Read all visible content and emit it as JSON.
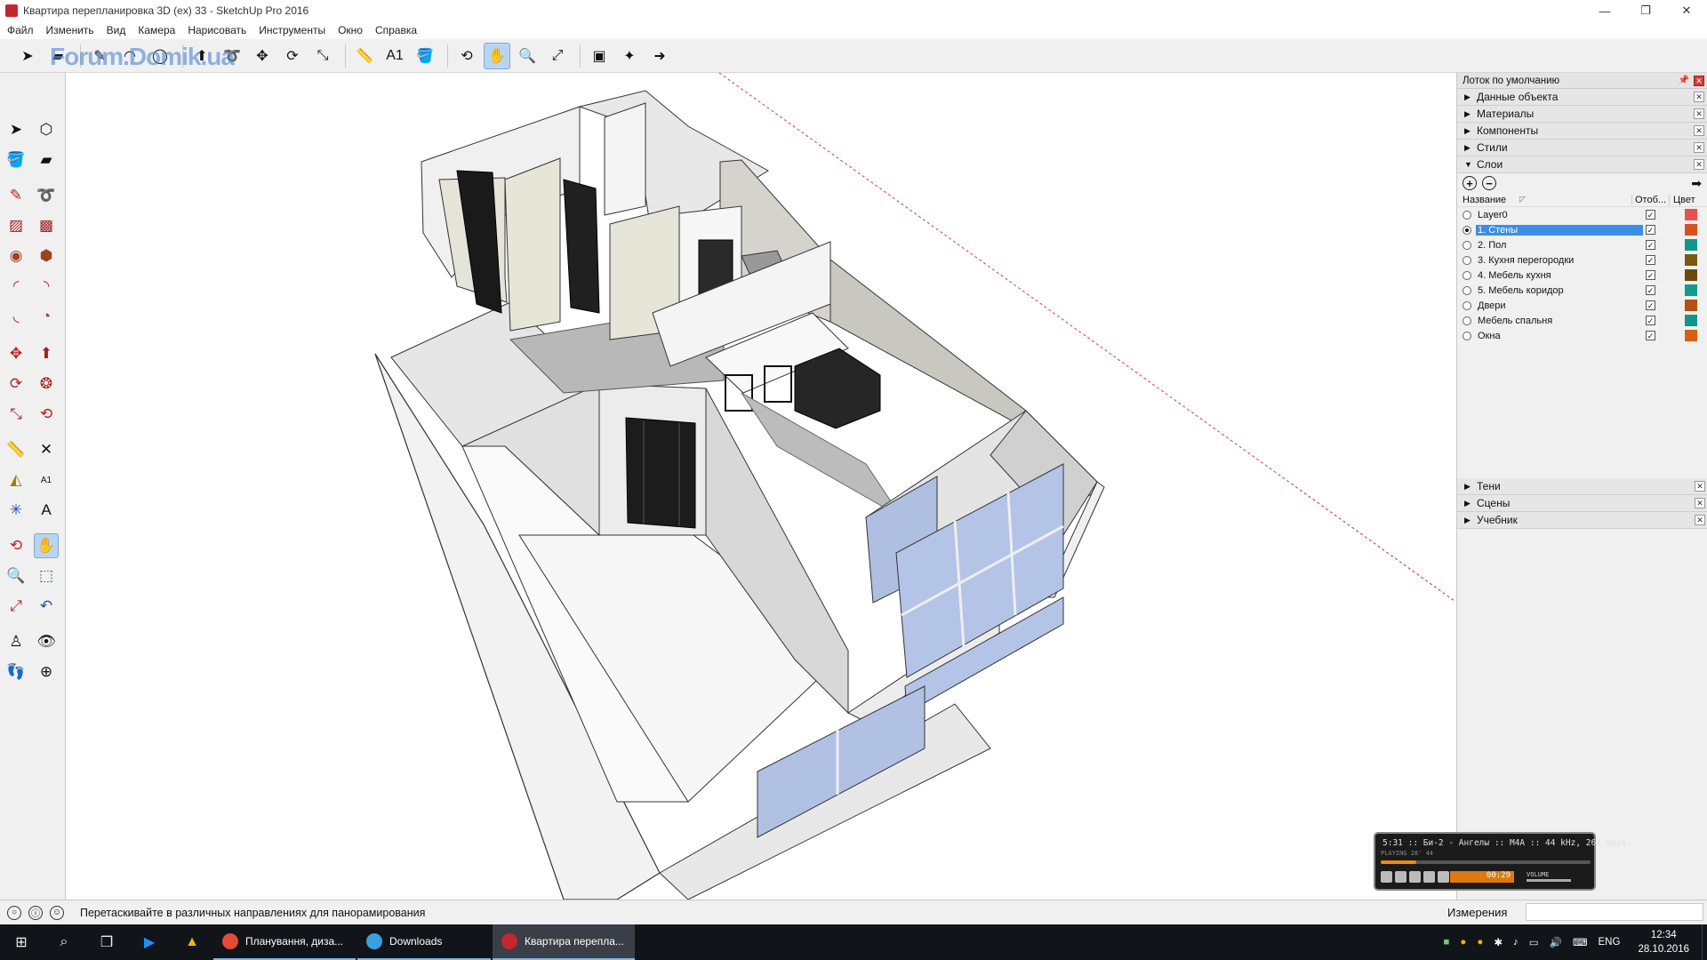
{
  "window": {
    "title": "Квартира перепланировка 3D (ex) 33 - SketchUp Pro 2016",
    "minimize": "—",
    "restore": "❐",
    "close": "✕"
  },
  "menu": [
    "Файл",
    "Изменить",
    "Вид",
    "Камера",
    "Нарисовать",
    "Инструменты",
    "Окно",
    "Справка"
  ],
  "watermark": "Forum.Domik.ua",
  "toolbar": {
    "icons": [
      "select-icon",
      "eraser-icon",
      "pencil-icon",
      "arc-icon",
      "circle-icon",
      "push-pull-icon",
      "follow-me-icon",
      "move-icon",
      "rotate-icon",
      "scale-icon",
      "tape-measure-icon",
      "text-label-icon",
      "paint-bucket-icon",
      "orbit-icon",
      "pan-icon",
      "zoom-icon",
      "zoom-extents-icon",
      "warehouse-icon",
      "extension-warehouse-icon",
      "send-to-layout-icon"
    ],
    "glyphs": [
      "➤",
      "▰",
      "✎",
      "◠",
      "◯",
      "⬆",
      "➰",
      "✥",
      "⟳",
      "⤡",
      "📏",
      "A1",
      "🪣",
      "⟲",
      "✋",
      "🔍",
      "⤢",
      "▣",
      "✦",
      "➜"
    ],
    "active_index": 14
  },
  "tray": {
    "title": "Лоток по умолчанию",
    "panels_top": [
      "Данные объекта",
      "Материалы",
      "Компоненты",
      "Стили"
    ],
    "layers_panel": "Слои",
    "layers_header": {
      "name": "Название",
      "visible": "Отоб...",
      "color": "Цвет"
    },
    "layers": [
      {
        "name": "Layer0",
        "active": false,
        "visible": true,
        "color": "#e8504a"
      },
      {
        "name": "1. Стены",
        "active": true,
        "visible": true,
        "color": "#d8501c"
      },
      {
        "name": "2. Пол",
        "active": false,
        "visible": true,
        "color": "#12968a"
      },
      {
        "name": "3. Кухня перегородки",
        "active": false,
        "visible": true,
        "color": "#7a5a08"
      },
      {
        "name": "4. Мебель кухня",
        "active": false,
        "visible": true,
        "color": "#6a4a0a"
      },
      {
        "name": "5. Мебель коридор",
        "active": false,
        "visible": true,
        "color": "#129a8c"
      },
      {
        "name": "Двери",
        "active": false,
        "visible": true,
        "color": "#b85010"
      },
      {
        "name": "Мебель спальня",
        "active": false,
        "visible": true,
        "color": "#12968a"
      },
      {
        "name": "Окна",
        "active": false,
        "visible": true,
        "color": "#d86010"
      }
    ],
    "panels_bottom": [
      "Тени",
      "Сцены",
      "Учебник"
    ]
  },
  "status": {
    "message": "Перетаскивайте в различных направлениях для панорамирования",
    "measurements_label": "Измерения",
    "measurements_value": ""
  },
  "player": {
    "track": "5:31 :: Би-2 - Ангелы :: M4A :: 44 kHz, 261 kbps.",
    "sub": "PLAYING   28'          44",
    "time": "00:29",
    "volume_label": "VOLUME"
  },
  "taskbar": {
    "tasks": [
      {
        "label": "Планування, диза...",
        "color": "#e44b35",
        "active": false
      },
      {
        "label": "Downloads",
        "color": "#3aa0e0",
        "active": false
      },
      {
        "label": "Квартира переплa...",
        "color": "#c4262e",
        "active": true
      }
    ],
    "lang": "ENG",
    "time": "12:34",
    "date": "28.10.2016"
  }
}
